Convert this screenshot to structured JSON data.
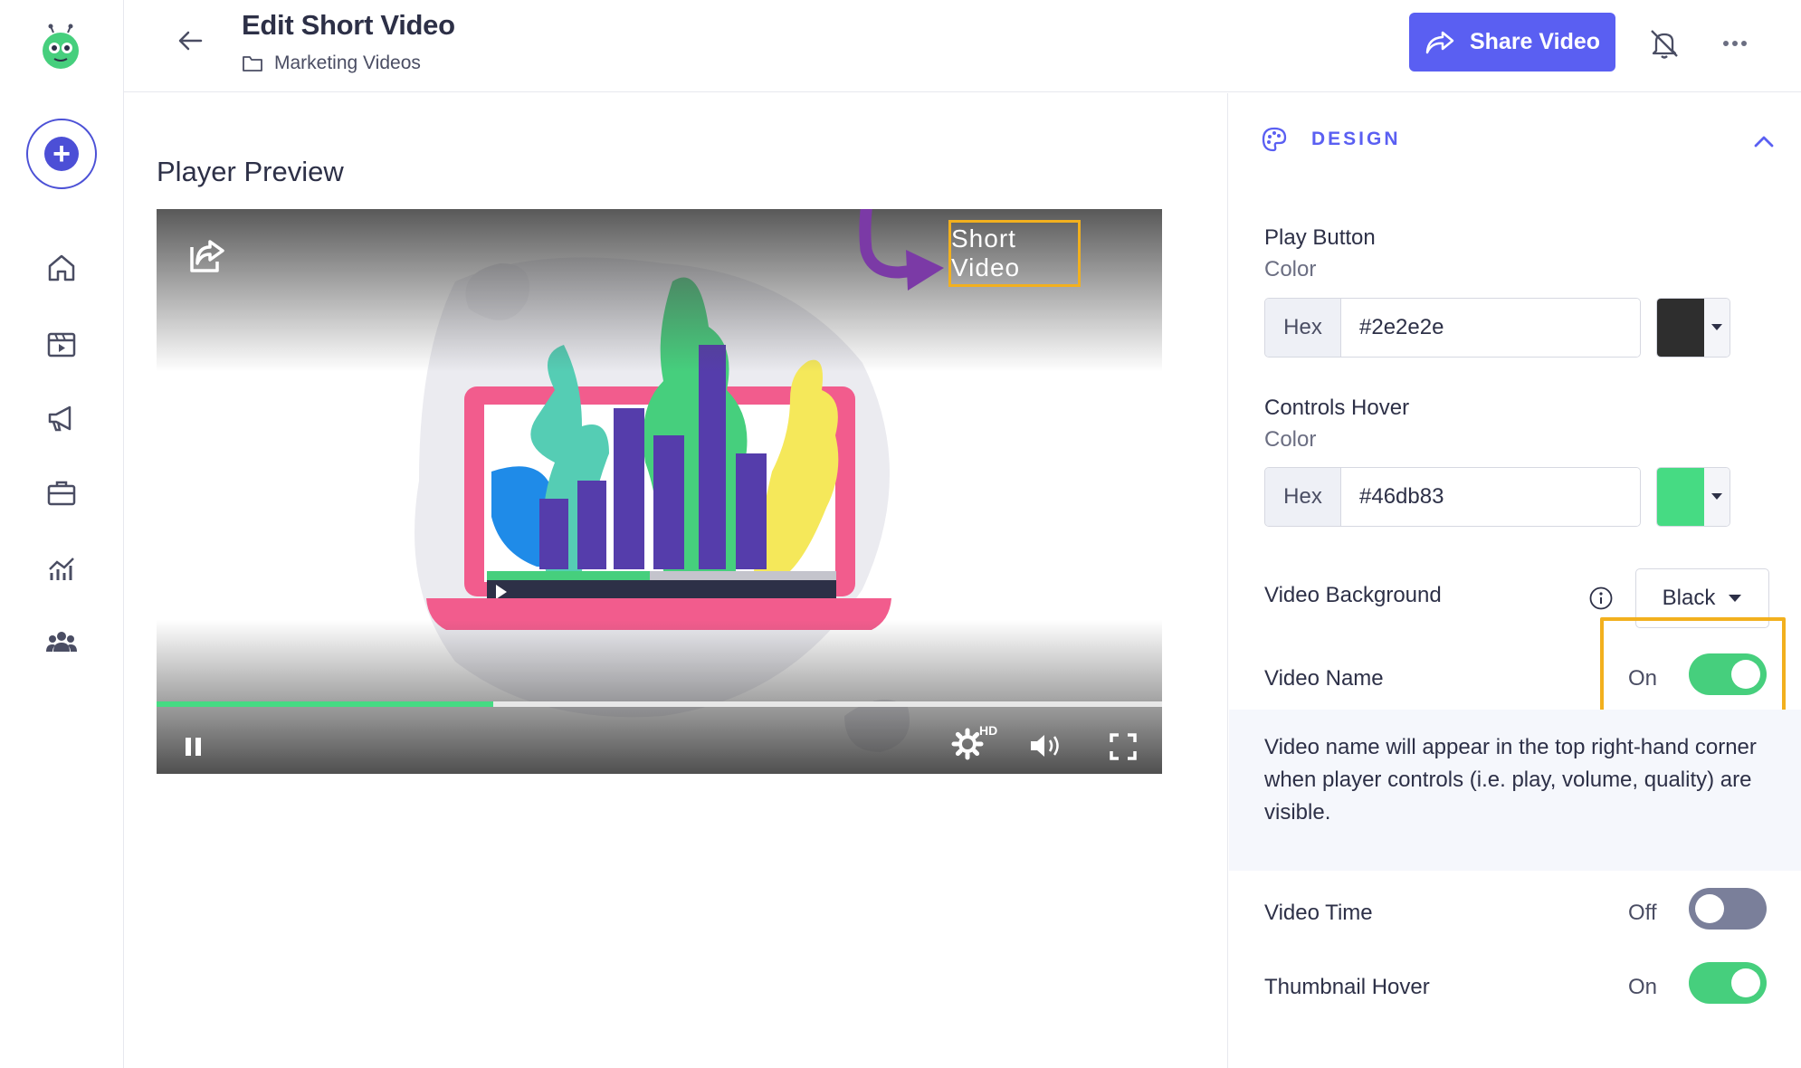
{
  "header": {
    "title": "Edit Short Video",
    "breadcrumb": "Marketing Videos",
    "share_label": "Share Video"
  },
  "main": {
    "section_label": "Player Preview",
    "player": {
      "video_name_overlay": "Short Video",
      "progress_fraction": 0.335,
      "quality_badge": "HD"
    }
  },
  "panel": {
    "section_title": "DESIGN",
    "play_button": {
      "label": "Play Button",
      "sublabel": "Color",
      "hex_tag": "Hex",
      "value": "#2e2e2e",
      "swatch_color": "#2e2e2e"
    },
    "controls_hover": {
      "label": "Controls Hover",
      "sublabel": "Color",
      "hex_tag": "Hex",
      "value": "#46db83",
      "swatch_color": "#46db83"
    },
    "video_background": {
      "label": "Video Background",
      "selected": "Black"
    },
    "video_name": {
      "label": "Video Name",
      "state": "On",
      "on": true,
      "helper": "Video name will appear in the top right-hand corner when player controls (i.e. play, volume, quality) are visible."
    },
    "video_time": {
      "label": "Video Time",
      "state": "Off",
      "on": false
    },
    "thumbnail_hover": {
      "label": "Thumbnail Hover",
      "state": "On",
      "on": true
    }
  },
  "colors": {
    "accent": "#5a5ff2",
    "toggle_on": "#46cf7d",
    "toggle_off": "#7a7f9a",
    "highlight": "#f2b01e",
    "annotation_arrow": "#7b3aa6"
  },
  "icons": {
    "nav": [
      "home-icon",
      "videos-icon",
      "campaigns-icon",
      "portfolio-icon",
      "analytics-icon",
      "team-icon"
    ]
  }
}
